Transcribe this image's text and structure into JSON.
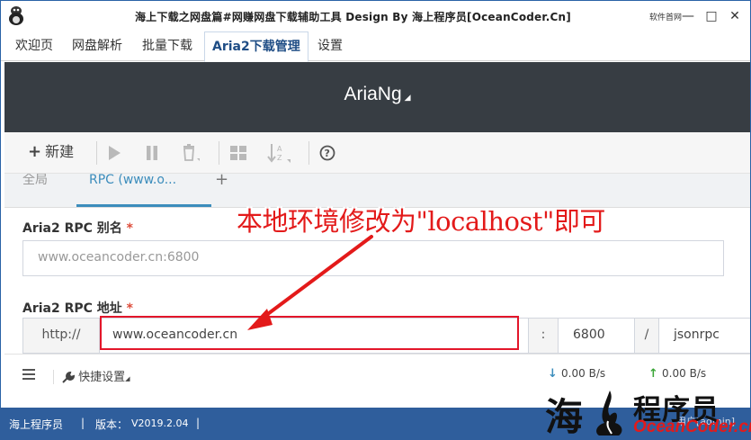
{
  "window": {
    "title": "海上下载之网盘篇#网赚网盘下载辅助工具 Design By 海上程序员[OceanCoder.Cn]",
    "software_label": "软件首网",
    "minimize": "—",
    "restore": "□",
    "close": "✕"
  },
  "app_tabs": [
    {
      "label": "欢迎页"
    },
    {
      "label": "网盘解析"
    },
    {
      "label": "批量下载"
    },
    {
      "label": "Aria2下载管理",
      "active": true
    },
    {
      "label": "设置"
    }
  ],
  "ariang": {
    "title": "AriaNg",
    "title_caret": "◢"
  },
  "toolbar": {
    "new_label": "新建",
    "new_icon": "plus-icon",
    "start_icon": "play-icon",
    "pause_icon": "pause-icon",
    "delete_icon": "trash-icon",
    "select_icon": "grid-icon",
    "sort_icon": "sort-az-icon",
    "help_icon": "question-circle-icon"
  },
  "settings_tabs": [
    {
      "label": "全局"
    },
    {
      "label": "RPC (www.o...",
      "active": true
    },
    {
      "label": "+"
    }
  ],
  "form": {
    "alias_label": "Aria2 RPC 别名",
    "alias_required": "*",
    "alias_value": "www.oceancoder.cn:6800",
    "address_label": "Aria2 RPC 地址",
    "address_required": "*",
    "protocol": "http://",
    "host": "www.oceancoder.cn",
    "port_sep": ":",
    "port": "6800",
    "path_sep": "/",
    "path": "jsonrpc"
  },
  "annotation": {
    "text": "本地环境修改为\"localhost\"即可",
    "color": "#e31a1a"
  },
  "aria_footer": {
    "menu_icon": "hamburger-icon",
    "quick_settings": "快捷设置",
    "quick_icon": "wrench-icon",
    "download_speed": "0.00 B/s",
    "upload_speed": "0.00 B/s"
  },
  "statusbar": {
    "brand": "海上程序员",
    "sep1": "|",
    "version_label": "版本：",
    "version": "V2019.2.04",
    "sep2": "|",
    "user": "用户[admin]"
  },
  "watermark": {
    "char": "海",
    "cn": "程序员",
    "en": "OceanCoder.cn"
  },
  "colors": {
    "header_bg": "#373d43",
    "statusbar_bg": "#2f5e9c",
    "accent": "#3c8dbc",
    "annotation_red": "#e31a1a"
  }
}
